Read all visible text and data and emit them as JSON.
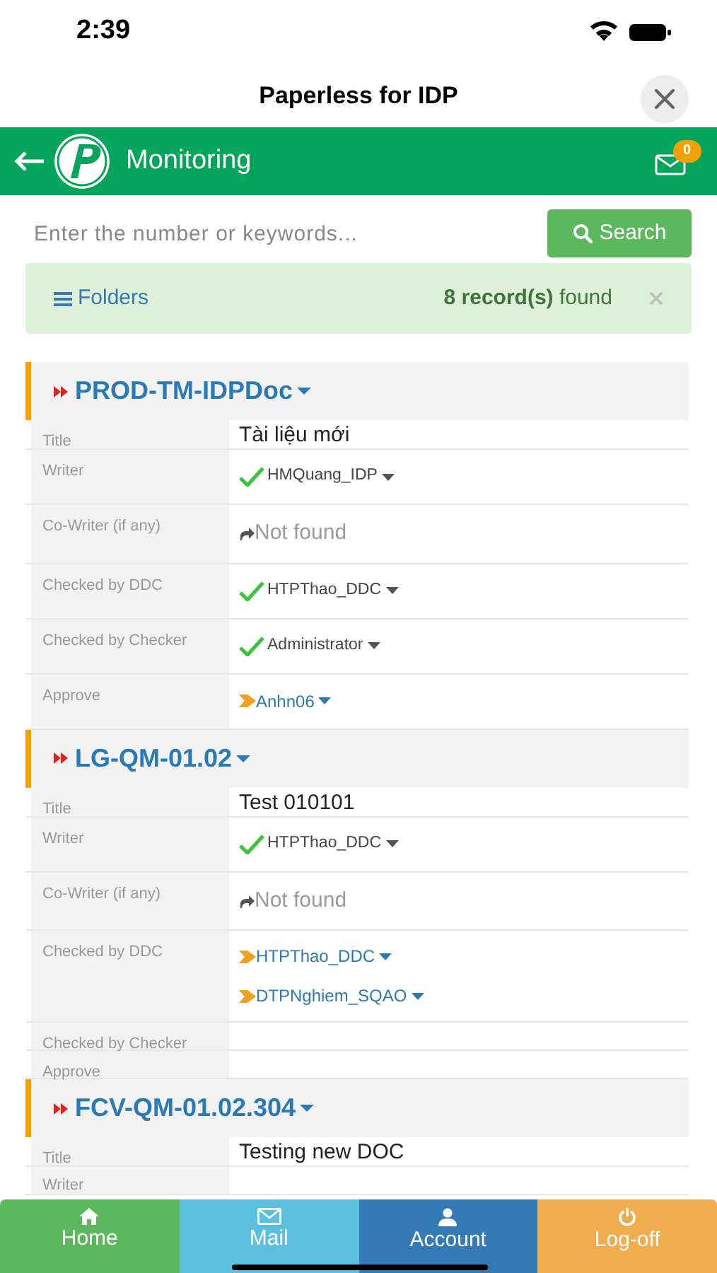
{
  "status_bar": {
    "time": "2:39"
  },
  "window": {
    "title": "Paperless for IDP"
  },
  "header": {
    "title": "Monitoring",
    "mail_count": "0"
  },
  "search": {
    "placeholder": "Enter the number or keywords...",
    "button": "Search"
  },
  "alert": {
    "folders": "Folders",
    "count": "**8 record(s)** found"
  },
  "records": [
    {
      "code": "PROD-TM-IDPDoc",
      "rows": [
        {
          "label": "Title",
          "kind": "text",
          "entries": [
            {
              "kind": "text",
              "text": "Tài liệu mới"
            }
          ]
        },
        {
          "label": "Writer",
          "kind": "people",
          "entries": [
            {
              "kind": "approved",
              "text": "HMQuang_IDP"
            }
          ]
        },
        {
          "label": "Co-Writer (if any)",
          "kind": "people",
          "entries": [
            {
              "kind": "not_found",
              "text": "Not found"
            }
          ]
        },
        {
          "label": "Checked by DDC",
          "kind": "people",
          "entries": [
            {
              "kind": "approved",
              "text": "HTPThao_DDC"
            }
          ]
        },
        {
          "label": "Checked by Checker",
          "kind": "people",
          "entries": [
            {
              "kind": "approved",
              "text": "Administrator"
            }
          ]
        },
        {
          "label": "Approve",
          "kind": "people",
          "entries": [
            {
              "kind": "pending",
              "text": "Anhn06"
            }
          ]
        }
      ]
    },
    {
      "code": "LG-QM-01.02",
      "rows": [
        {
          "label": "Title",
          "kind": "text",
          "entries": [
            {
              "kind": "text",
              "text": "Test 010101"
            }
          ]
        },
        {
          "label": "Writer",
          "kind": "people",
          "entries": [
            {
              "kind": "approved",
              "text": "HTPThao_DDC"
            }
          ]
        },
        {
          "label": "Co-Writer (if any)",
          "kind": "people",
          "entries": [
            {
              "kind": "not_found",
              "text": "Not found"
            }
          ]
        },
        {
          "label": "Checked by DDC",
          "kind": "people",
          "entries": [
            {
              "kind": "pending",
              "text": "HTPThao_DDC"
            },
            {
              "kind": "pending",
              "text": "DTPNghiem_SQAO"
            }
          ]
        },
        {
          "label": "Checked by Checker",
          "kind": "empty"
        },
        {
          "label": "Approve",
          "kind": "empty"
        }
      ]
    },
    {
      "code": "FCV-QM-01.02.304",
      "rows": [
        {
          "label": "Title",
          "kind": "text",
          "entries": [
            {
              "kind": "text",
              "text": "Testing new DOC"
            }
          ]
        },
        {
          "label": "Writer",
          "kind": "cut"
        }
      ]
    }
  ],
  "nav": [
    {
      "kind": "home",
      "label": "Home"
    },
    {
      "kind": "mail",
      "label": "Mail"
    },
    {
      "kind": "account",
      "label": "Account"
    },
    {
      "kind": "logoff",
      "label": "Log-off"
    }
  ]
}
